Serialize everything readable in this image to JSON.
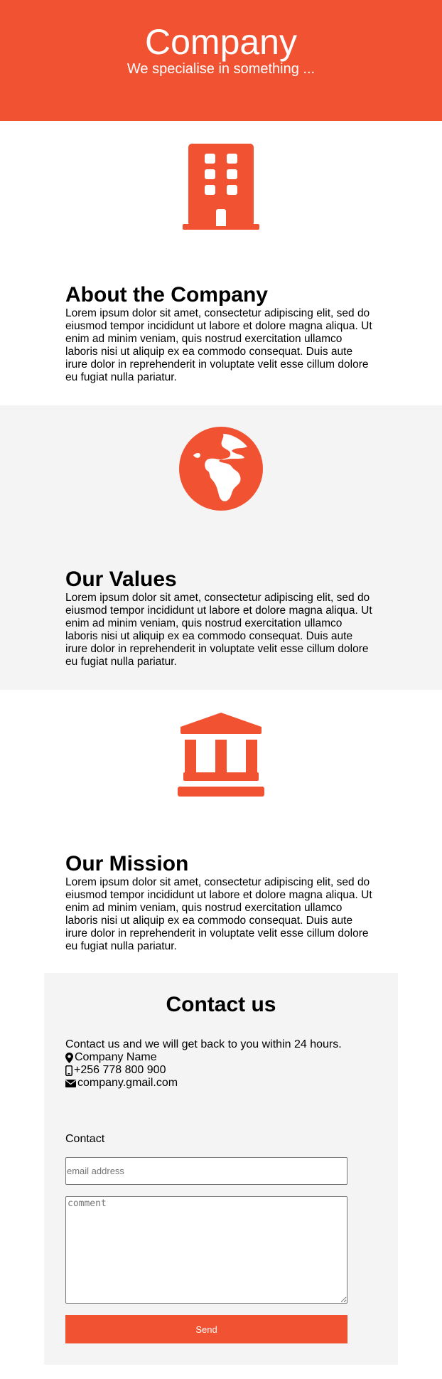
{
  "header": {
    "title": "Company",
    "subtitle": "We specialise in something ..."
  },
  "theme": {
    "accent": "#f15232",
    "section_alt_bg": "#f4f4f4"
  },
  "sections": [
    {
      "icon": "building-icon",
      "heading": "About the Company",
      "body": "Lorem ipsum dolor sit amet, consectetur adipiscing elit, sed do eiusmod tempor incididunt ut labore et dolore magna aliqua. Ut enim ad minim veniam, quis nostrud exercitation ullamco laboris nisi ut aliquip ex ea commodo consequat. Duis aute irure dolor in reprehenderit in voluptate velit esse cillum dolore eu fugiat nulla pariatur."
    },
    {
      "icon": "globe-africa-icon",
      "heading": "Our Values",
      "body": "Lorem ipsum dolor sit amet, consectetur adipiscing elit, sed do eiusmod tempor incididunt ut labore et dolore magna aliqua. Ut enim ad minim veniam, quis nostrud exercitation ullamco laboris nisi ut aliquip ex ea commodo consequat. Duis aute irure dolor in reprehenderit in voluptate velit esse cillum dolore eu fugiat nulla pariatur."
    },
    {
      "icon": "institution-icon",
      "heading": "Our Mission",
      "body": "Lorem ipsum dolor sit amet, consectetur adipiscing elit, sed do eiusmod tempor incididunt ut labore et dolore magna aliqua. Ut enim ad minim veniam, quis nostrud exercitation ullamco laboris nisi ut aliquip ex ea commodo consequat. Duis aute irure dolor in reprehenderit in voluptate velit esse cillum dolore eu fugiat nulla pariatur."
    }
  ],
  "contact": {
    "heading": "Contact us",
    "intro": "Contact us and we will get back to you within 24 hours.",
    "company_name": "Company Name",
    "phone": "+256 778 800 900",
    "email": "company.gmail.com",
    "form_label": "Contact",
    "email_placeholder": "email address",
    "comment_placeholder": "comment",
    "send_label": "Send"
  }
}
